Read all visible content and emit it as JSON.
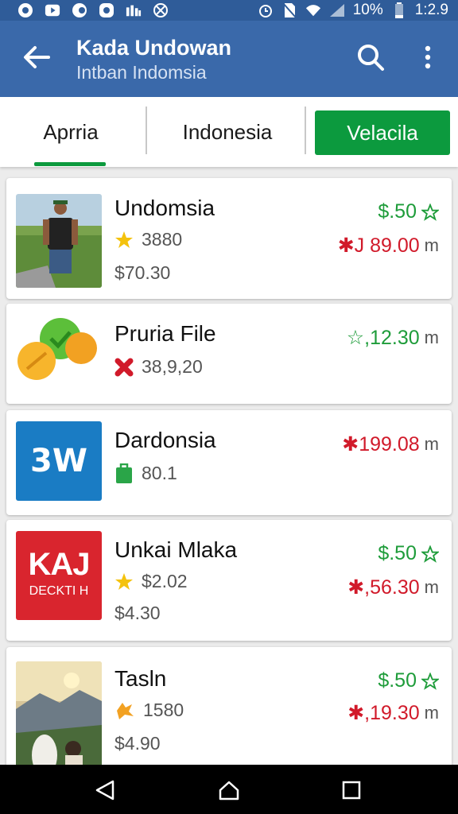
{
  "status_bar": {
    "battery_text": "10%",
    "time": "1:2.9"
  },
  "app_bar": {
    "title": "Kada Undowan",
    "subtitle": "Intban Indomsia"
  },
  "tabs": [
    {
      "label": "Aprria",
      "selected": true
    },
    {
      "label": "Indonesia",
      "selected": false
    },
    {
      "label": "Velacila",
      "selected": false,
      "style": "button"
    }
  ],
  "items": [
    {
      "name": "Undomsia",
      "meta": "3880",
      "meta_icon": "star-icon",
      "price": "$70.30",
      "right_top": "$.50",
      "right_top_icon": "star-outline-icon",
      "right_bottom": "✱J 89.00",
      "right_bottom_unit": "m"
    },
    {
      "name": "Pruria File",
      "meta": "38,9,20",
      "meta_icon": "red-cross-icon",
      "price": "",
      "right_top": "☆,12.30",
      "right_top_unit": "m"
    },
    {
      "name": "Dardonsia",
      "meta": "80.1",
      "meta_icon": "green-bag-icon",
      "price": "",
      "right_top": "✱199.08",
      "right_top_unit": "m"
    },
    {
      "name": "Unkai Mlaka",
      "meta": "$2.02",
      "meta_icon": "star-icon",
      "price": "$4.30",
      "right_top": "$.50",
      "right_top_icon": "star-outline-icon",
      "right_bottom": "✱,56.30",
      "right_bottom_unit": "m",
      "logo_text_top": "KAJ",
      "logo_text_bottom": "DECKTI H"
    },
    {
      "name": "Tasln",
      "meta": "1580",
      "meta_icon": "badge-icon",
      "price": "$4.90",
      "right_top": "$.50",
      "right_top_icon": "star-outline-icon",
      "right_bottom": "✱,19.30",
      "right_bottom_unit": "m"
    }
  ],
  "logo_3w": "3W",
  "colors": {
    "primary": "#3a69aa",
    "status": "#2f5c99",
    "accent_green": "#0c9a3e",
    "price_green": "#1e9c3a",
    "price_red": "#d11a2a"
  }
}
